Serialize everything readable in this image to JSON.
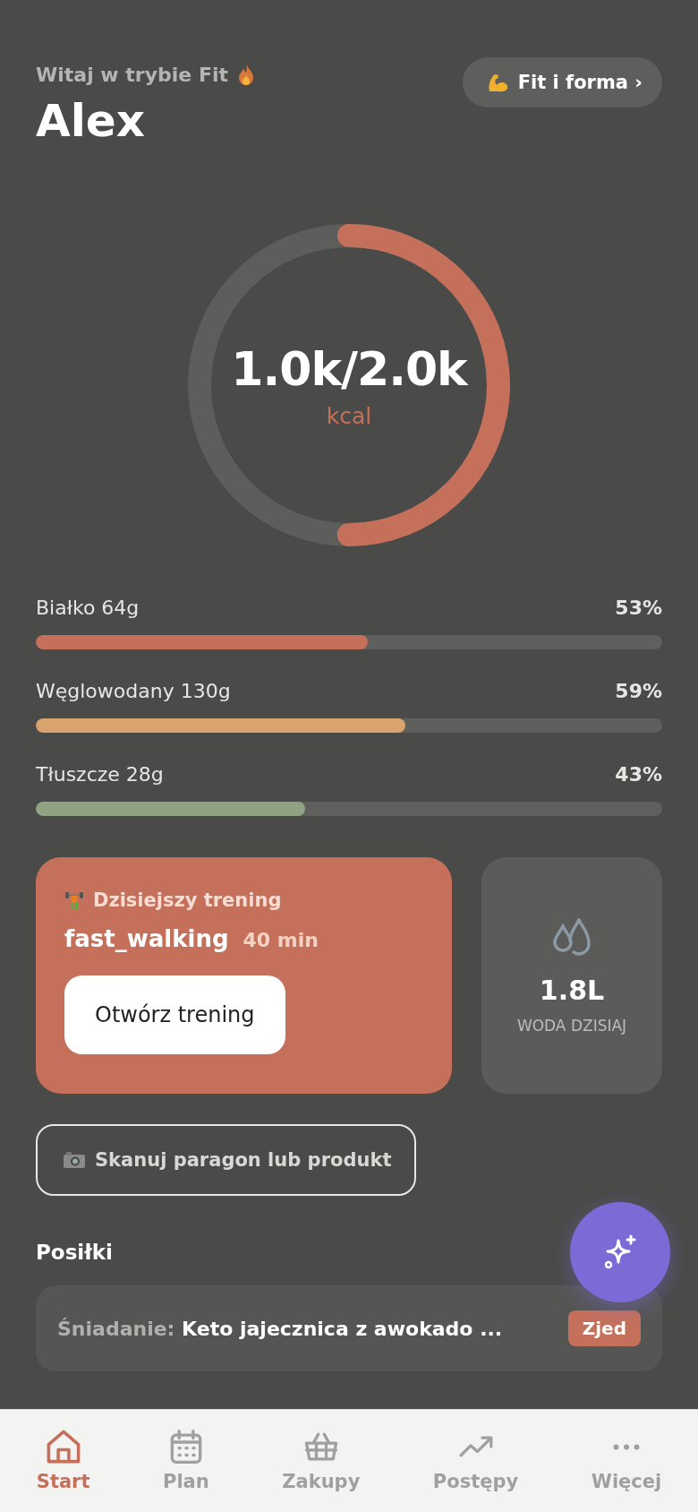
{
  "header": {
    "greeting": "Witaj w trybie Fit",
    "name": "Alex",
    "mode_button": "Fit i forma ›"
  },
  "calories": {
    "value": "1.0k/2.0k",
    "unit": "kcal",
    "level": 0.5
  },
  "macros": [
    {
      "label": "Białko 64g",
      "percent": "53%",
      "level": 0.53,
      "color": "#c5705a"
    },
    {
      "label": "Węglowodany 130g",
      "percent": "59%",
      "level": 0.59,
      "color": "#d8a36c"
    },
    {
      "label": "Tłuszcze 28g",
      "percent": "43%",
      "level": 0.43,
      "color": "#8fa283"
    }
  ],
  "workout": {
    "title": "Dzisiejszy trening",
    "name": "fast_walking",
    "duration": "40 min",
    "button": "Otwórz trening"
  },
  "water": {
    "value": "1.8L",
    "label": "WODA DZISIAJ"
  },
  "scan_button": "Skanuj paragon lub produkt",
  "meals": {
    "title": "Posiłki",
    "items": [
      {
        "type": "Śniadanie:",
        "name": "Keto jajecznica z awokado ...",
        "action": "Zjed"
      }
    ]
  },
  "nav": [
    {
      "label": "Start",
      "selected": true
    },
    {
      "label": "Plan",
      "selected": false
    },
    {
      "label": "Zakupy",
      "selected": false
    },
    {
      "label": "Postępy",
      "selected": false
    },
    {
      "label": "Więcej",
      "selected": false
    }
  ]
}
